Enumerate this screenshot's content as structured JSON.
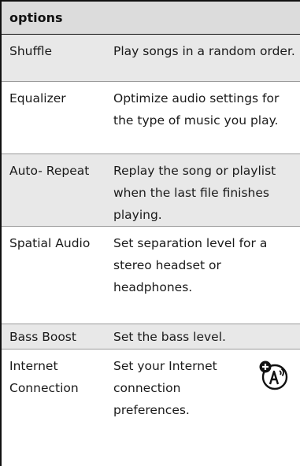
{
  "table": {
    "header": "options",
    "rows": [
      {
        "name": "Shuffle",
        "desc": "Play songs in a random order."
      },
      {
        "name": "Equalizer",
        "desc": "Optimize audio settings for the type of music you play."
      },
      {
        "name": "Auto- Repeat",
        "desc": "Replay the song or playlist when the last file finishes playing."
      },
      {
        "name": "Spatial Audio",
        "desc": "Set separation level for a stereo headset or headphones."
      },
      {
        "name": "Bass Boost",
        "desc": "Set the bass level."
      },
      {
        "name": "Internet Connection",
        "desc": "Set your Internet connection preferences."
      }
    ]
  },
  "icons": {
    "accessory": "accessory-icon"
  },
  "colors": {
    "header_bg": "#dcdcdc",
    "shaded_row_bg": "#e8e8e8",
    "border": "#111111"
  }
}
